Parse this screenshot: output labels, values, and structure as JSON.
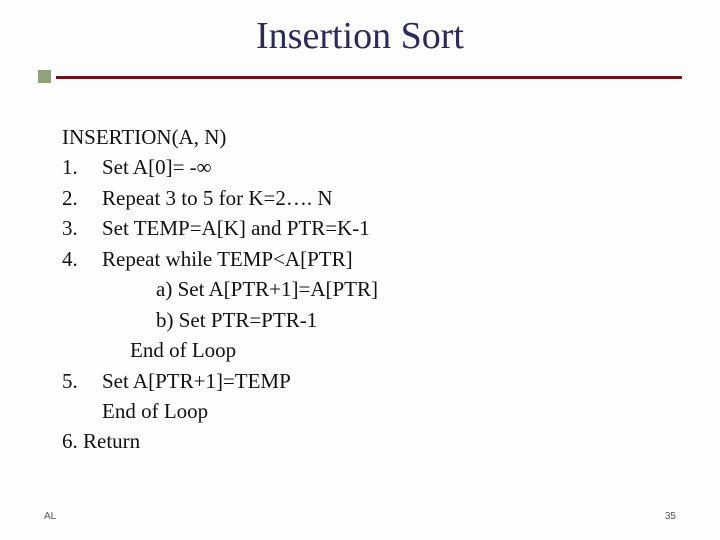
{
  "title": "Insertion Sort",
  "algo": {
    "header": "INSERTION(A, N)",
    "steps": [
      {
        "n": "1.",
        "text": "Set A[0]= -∞"
      },
      {
        "n": "2.",
        "text": "Repeat 3 to 5 for K=2…. N"
      },
      {
        "n": "3.",
        "text": "Set TEMP=A[K]  and PTR=K-1"
      },
      {
        "n": "4.",
        "text": "Repeat while TEMP<A[PTR]"
      }
    ],
    "sub_a": "a) Set A[PTR+1]=A[PTR]",
    "sub_b": "b) Set PTR=PTR-1",
    "end1": "End of Loop",
    "step5": {
      "n": "5.",
      "text": "Set A[PTR+1]=TEMP"
    },
    "end2": "End of Loop",
    "step6": "6. Return"
  },
  "footer": {
    "left": "AL",
    "right": "35"
  }
}
